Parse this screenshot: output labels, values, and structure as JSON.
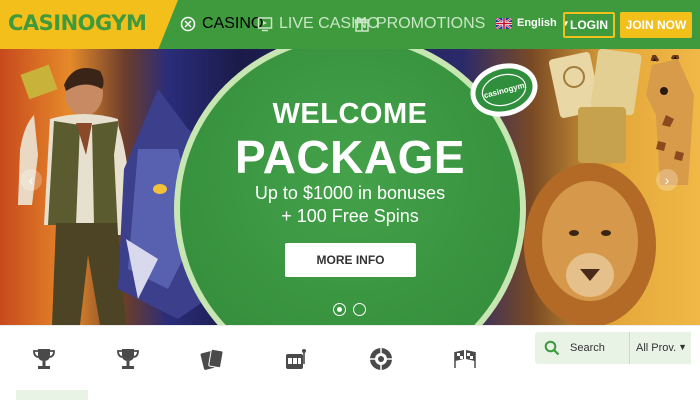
{
  "header": {
    "logo": "CASINOGYM",
    "nav": [
      {
        "label": "CASINO",
        "icon": "casino-chip-icon",
        "active": true
      },
      {
        "label": "LIVE CASINO",
        "icon": "live-screen-icon",
        "active": false
      },
      {
        "label": "PROMOTIONS",
        "icon": "gift-icon",
        "active": false
      }
    ],
    "language": {
      "label": "English",
      "flag": "uk-flag-icon"
    },
    "login_label": "LOGIN",
    "join_label": "JOIN NOW"
  },
  "hero": {
    "title_line1": "WELCOME",
    "title_line2": "PACKAGE",
    "subtitle_line1": "Up to $1000 in bonuses",
    "subtitle_line2": "+ 100 Free Spins",
    "cta_label": "MORE INFO",
    "chip_text": "casinogym",
    "prev_arrow": "‹",
    "next_arrow": "›",
    "slides": 2,
    "active_slide": 1
  },
  "categories": [
    {
      "icon": "trophy-icon"
    },
    {
      "icon": "trophy-alt-icon"
    },
    {
      "icon": "cards-icon"
    },
    {
      "icon": "slot-machine-icon"
    },
    {
      "icon": "roulette-icon"
    },
    {
      "icon": "checkered-flags-icon"
    }
  ],
  "search": {
    "label": "Search",
    "provider_selected": "All Prov."
  },
  "colors": {
    "brand_green": "#3e9a3d",
    "brand_yellow": "#f2bf1b",
    "search_bg": "#e8f3e6"
  }
}
